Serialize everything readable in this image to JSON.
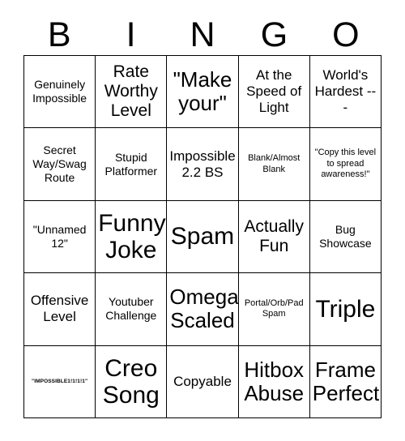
{
  "card": {
    "title": "BINGO",
    "header_letters": [
      "B",
      "I",
      "N",
      "G",
      "O"
    ],
    "grid_size": {
      "columns": 5,
      "rows": 5
    },
    "colors": {
      "background": "#ffffff",
      "cell_background": "#ffffff",
      "border": "#000000",
      "text": "#000000"
    },
    "rows": [
      [
        {
          "text": "Genuinely Impossible",
          "size": "sm"
        },
        {
          "text": "Rate Worthy Level",
          "size": "lg"
        },
        {
          "text": "\"Make your\"",
          "size": "xl"
        },
        {
          "text": "At the Speed of Light",
          "size": "md"
        },
        {
          "text": "World's Hardest ---",
          "size": "md"
        }
      ],
      [
        {
          "text": "Secret Way/Swag Route",
          "size": "sm"
        },
        {
          "text": "Stupid Platformer",
          "size": "sm"
        },
        {
          "text": "Impossible 2.2 BS",
          "size": "md"
        },
        {
          "text": "Blank/Almost Blank",
          "size": "xs"
        },
        {
          "text": "\"Copy this level to spread awareness!\"",
          "size": "xs"
        }
      ],
      [
        {
          "text": "\"Unnamed 12\"",
          "size": "sm"
        },
        {
          "text": "Funny Joke",
          "size": "xxl"
        },
        {
          "text": "Spam",
          "size": "xxl"
        },
        {
          "text": "Actually Fun",
          "size": "lg"
        },
        {
          "text": "Bug Showcase",
          "size": "sm"
        }
      ],
      [
        {
          "text": "Offensive Level",
          "size": "md"
        },
        {
          "text": "Youtuber Challenge",
          "size": "sm"
        },
        {
          "text": "Omega Scaled",
          "size": "xl"
        },
        {
          "text": "Portal/Orb/Pad Spam",
          "size": "xs"
        },
        {
          "text": "Triple",
          "size": "xxl"
        }
      ],
      [
        {
          "text": "\"IMPOSSIBLE1!1!1!1\"",
          "size": "xxs"
        },
        {
          "text": "Creo Song",
          "size": "xxl"
        },
        {
          "text": "Copyable",
          "size": "md"
        },
        {
          "text": "Hitbox Abuse",
          "size": "xl"
        },
        {
          "text": "Frame Perfect",
          "size": "xl"
        }
      ]
    ]
  }
}
